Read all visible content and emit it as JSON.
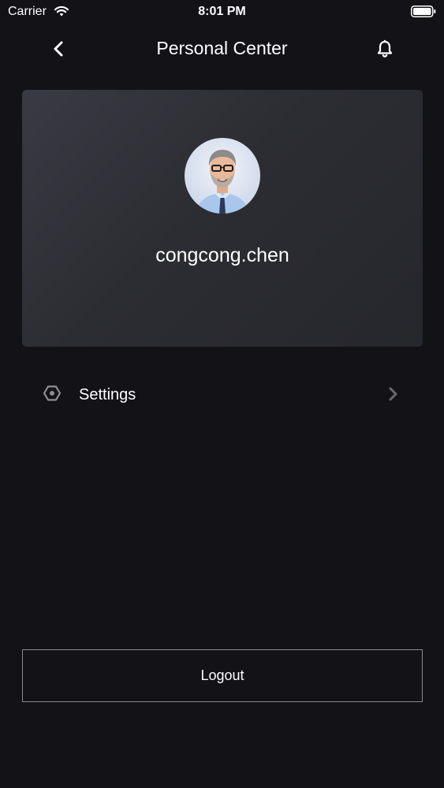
{
  "status_bar": {
    "carrier": "Carrier",
    "time": "8:01 PM"
  },
  "nav": {
    "title": "Personal Center",
    "back_icon": "chevron-left-icon",
    "bell_icon": "bell-icon"
  },
  "profile": {
    "username": "congcong.chen"
  },
  "menu": {
    "settings_label": "Settings",
    "settings_icon": "gear-icon"
  },
  "actions": {
    "logout_label": "Logout"
  },
  "colors": {
    "background": "#121217",
    "card": "#2e2f35",
    "text": "#ffffff",
    "muted_icon": "#8e8e93",
    "border": "#8a8a8f"
  }
}
